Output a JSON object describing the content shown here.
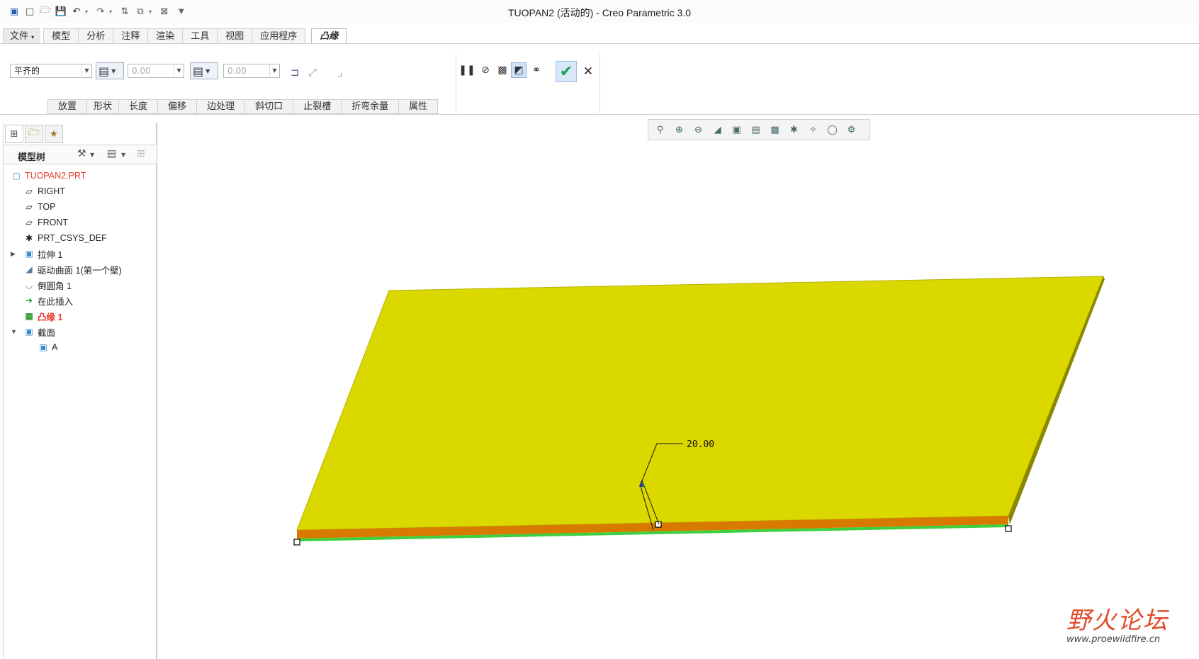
{
  "window": {
    "title": "TUOPAN2 (活动的) - Creo Parametric 3.0"
  },
  "quick_access": {
    "icons": [
      "window-icon",
      "new-icon",
      "open-icon",
      "save-icon",
      "undo-icon",
      "redo-icon",
      "regenerate-icon",
      "windows-icon",
      "close-window-icon",
      "customize-icon"
    ]
  },
  "menu": {
    "file": "文件",
    "tabs": [
      "模型",
      "分析",
      "注释",
      "渲染",
      "工具",
      "视图",
      "应用程序"
    ],
    "active_tab": "凸缘"
  },
  "ribbon": {
    "shape_select": "平齐的",
    "length1": "0.00",
    "length2": "0.00",
    "subtabs": [
      "放置",
      "形状",
      "长度",
      "偏移",
      "边处理",
      "斜切口",
      "止裂槽",
      "折弯余量",
      "属性"
    ]
  },
  "model_tree": {
    "header": "模型树",
    "items": [
      {
        "label": "TUOPAN2.PRT",
        "icon": "part-icon"
      },
      {
        "label": "RIGHT",
        "icon": "datum-plane-icon"
      },
      {
        "label": "TOP",
        "icon": "datum-plane-icon"
      },
      {
        "label": "FRONT",
        "icon": "datum-plane-icon"
      },
      {
        "label": "PRT_CSYS_DEF",
        "icon": "csys-icon"
      },
      {
        "label": "拉伸 1",
        "icon": "extrude-icon"
      },
      {
        "label": "驱动曲面 1(第一个壁)",
        "icon": "driving-surface-icon"
      },
      {
        "label": "倒圆角 1",
        "icon": "round-icon"
      },
      {
        "label": "在此插入",
        "icon": "insert-here-icon"
      },
      {
        "label": "凸缘 1",
        "icon": "flange-icon"
      },
      {
        "label": "截面",
        "icon": "section-icon"
      },
      {
        "label": "A",
        "icon": "section-a-icon"
      }
    ]
  },
  "graphics": {
    "dimension": "20.00",
    "colors": {
      "top_face": "#dbd800",
      "edge_wall": "#d97a00",
      "bottom_edge": "#3ecf3e"
    }
  },
  "watermark": {
    "main": "野火论坛",
    "url": "www.proewildfire.cn"
  }
}
